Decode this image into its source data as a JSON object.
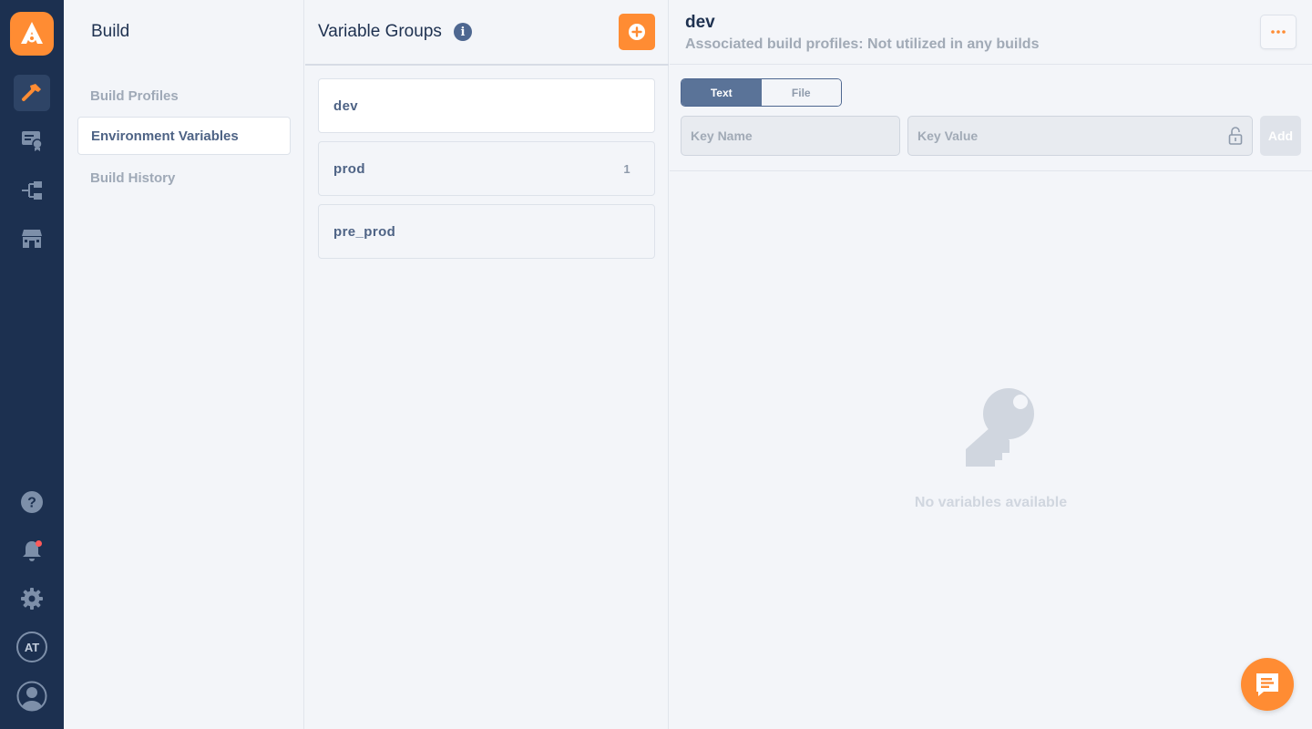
{
  "colors": {
    "rail_bg": "#1c3050",
    "accent": "#ff8c33",
    "primary_text": "#1e3150",
    "muted_text": "#a1aab6",
    "toggle_active": "#5a7398",
    "notification_dot": "#ff5a5a"
  },
  "rail": {
    "logo_icon": "appcircle-logo-icon",
    "items": [
      {
        "icon": "hammer-icon",
        "active": true
      },
      {
        "icon": "certificate-icon",
        "active": false
      },
      {
        "icon": "distribution-flow-icon",
        "active": false
      },
      {
        "icon": "store-icon",
        "active": false
      }
    ],
    "bottom": [
      {
        "icon": "help-icon"
      },
      {
        "icon": "bell-icon",
        "has_notification": true
      },
      {
        "icon": "gear-icon"
      }
    ],
    "org_initials": "AT",
    "profile_icon": "user-avatar-icon"
  },
  "nav": {
    "title": "Build",
    "items": [
      {
        "label": "Build Profiles",
        "active": false
      },
      {
        "label": "Environment Variables",
        "active": true
      },
      {
        "label": "Build History",
        "active": false
      }
    ]
  },
  "groups": {
    "title": "Variable Groups",
    "info_icon": "info-icon",
    "add_icon": "plus-circle-icon",
    "items": [
      {
        "name": "dev",
        "count": "",
        "active": true
      },
      {
        "name": "prod",
        "count": "1",
        "active": false
      },
      {
        "name": "pre_prod",
        "count": "",
        "active": false
      }
    ]
  },
  "detail": {
    "title": "dev",
    "subtitle": "Associated build profiles: Not utilized in any builds",
    "more_icon": "more-horizontal-icon",
    "toggle": {
      "options": [
        "Text",
        "File"
      ],
      "selected": "Text"
    },
    "key_name": {
      "placeholder": "Key Name",
      "value": ""
    },
    "key_value": {
      "placeholder": "Key Value",
      "value": "",
      "lock_icon": "unlock-icon"
    },
    "add_label": "Add",
    "empty": {
      "icon": "key-icon",
      "text": "No variables available"
    }
  },
  "chat": {
    "icon": "chat-message-icon"
  }
}
